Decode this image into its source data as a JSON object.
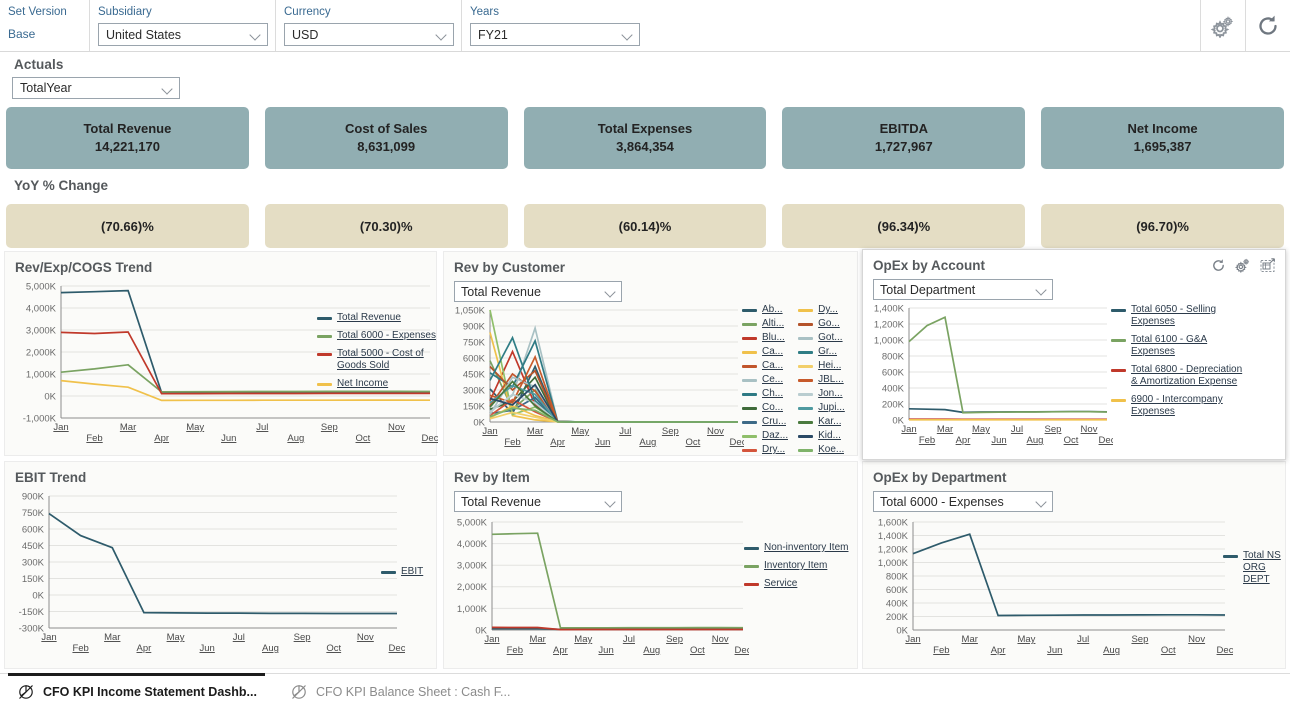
{
  "filters": {
    "set_version": {
      "label": "Set Version",
      "value": "Base"
    },
    "subsidiary": {
      "label": "Subsidiary",
      "value": "United States"
    },
    "currency": {
      "label": "Currency",
      "value": "USD"
    },
    "years": {
      "label": "Years",
      "value": "FY21"
    },
    "icons": {
      "settings": "gear-icon",
      "refresh": "refresh-icon"
    }
  },
  "actuals": {
    "title": "Actuals",
    "period_selector": "TotalYear",
    "kpis": [
      {
        "label": "Total Revenue",
        "value": "14,221,170"
      },
      {
        "label": "Cost of Sales",
        "value": "8,631,099"
      },
      {
        "label": "Total Expenses",
        "value": "3,864,354"
      },
      {
        "label": "EBITDA",
        "value": "1,727,967"
      },
      {
        "label": "Net Income",
        "value": "1,695,387"
      }
    ]
  },
  "yoy": {
    "title": "YoY % Change",
    "values": [
      "(70.66)%",
      "(70.30)%",
      "(60.14)%",
      "(96.34)%",
      "(96.70)%"
    ]
  },
  "colors": {
    "kpi_tile": "#91aeb2",
    "yoy_tile": "#e4ddc4",
    "teal": "#2e5b6b",
    "green": "#7aa362",
    "red": "#c0392b",
    "yellow": "#f0c14b",
    "label_blue": "#3a6a91"
  },
  "months": [
    "Jan",
    "Feb",
    "Mar",
    "Apr",
    "May",
    "Jun",
    "Jul",
    "Aug",
    "Sep",
    "Oct",
    "Nov",
    "Dec"
  ],
  "chart_data": [
    {
      "id": "rev_exp_cogs_trend",
      "type": "line",
      "title": "Rev/Exp/COGS Trend",
      "x": [
        "Jan",
        "Feb",
        "Mar",
        "Apr",
        "May",
        "Jun",
        "Jul",
        "Aug",
        "Sep",
        "Oct",
        "Nov",
        "Dec"
      ],
      "xlabel": "",
      "ylabel": "",
      "ylim": [
        -1000,
        5000
      ],
      "yticks": [
        "5,000K",
        "4,000K",
        "3,000K",
        "2,000K",
        "1,000K",
        "0K",
        "-1,000K"
      ],
      "grid": true,
      "legend_position": "right",
      "series": [
        {
          "name": "Total Revenue",
          "color": "#2e5b6b",
          "values": [
            4700,
            4740,
            4790,
            150,
            160,
            160,
            165,
            165,
            165,
            165,
            165,
            160
          ]
        },
        {
          "name": "Total 6000 - Expenses",
          "color": "#7aa362",
          "values": [
            1080,
            1230,
            1420,
            185,
            195,
            200,
            205,
            205,
            208,
            210,
            210,
            205
          ]
        },
        {
          "name": "Total 5000 - Cost of Goods Sold",
          "color": "#c0392b",
          "values": [
            2890,
            2840,
            2910,
            105,
            110,
            112,
            115,
            115,
            118,
            120,
            120,
            118
          ]
        },
        {
          "name": "Net Income",
          "color": "#f0c14b",
          "values": [
            700,
            540,
            400,
            -200,
            -195,
            -195,
            -190,
            -190,
            -190,
            -188,
            -188,
            -190
          ]
        }
      ]
    },
    {
      "id": "rev_by_customer",
      "type": "line",
      "title": "Rev by Customer",
      "selector": "Total Revenue",
      "x": [
        "Jan",
        "Feb",
        "Mar",
        "Apr",
        "May",
        "Jun",
        "Jul",
        "Aug",
        "Sep",
        "Oct",
        "Nov",
        "Dec"
      ],
      "ylim": [
        0,
        1050
      ],
      "yticks": [
        "1,050K",
        "900K",
        "750K",
        "600K",
        "450K",
        "300K",
        "150K",
        "0K"
      ],
      "grid": true,
      "legend_position": "right",
      "legend_columns": 2,
      "series": [
        {
          "name": "Ab...",
          "color": "#2e5b6b",
          "values": [
            310,
            80,
            520,
            5,
            0,
            0,
            0,
            0,
            0,
            0,
            0,
            0
          ]
        },
        {
          "name": "Alti...",
          "color": "#7aa362",
          "values": [
            575,
            120,
            300,
            4,
            0,
            0,
            0,
            0,
            0,
            0,
            0,
            0
          ]
        },
        {
          "name": "Blu...",
          "color": "#c0392b",
          "values": [
            200,
            660,
            160,
            3,
            0,
            0,
            0,
            0,
            0,
            0,
            0,
            0
          ]
        },
        {
          "name": "Ca...",
          "color": "#f0c14b",
          "values": [
            840,
            60,
            20,
            2,
            0,
            0,
            0,
            0,
            0,
            0,
            0,
            0
          ]
        },
        {
          "name": "Ca...",
          "color": "#c1552c",
          "values": [
            150,
            450,
            290,
            3,
            0,
            0,
            0,
            0,
            0,
            0,
            0,
            0
          ]
        },
        {
          "name": "Ce...",
          "color": "#a9c1c4",
          "values": [
            100,
            250,
            880,
            4,
            0,
            0,
            0,
            0,
            0,
            0,
            0,
            0
          ]
        },
        {
          "name": "Ch...",
          "color": "#2e7a84",
          "values": [
            460,
            330,
            760,
            6,
            0,
            0,
            0,
            0,
            0,
            0,
            0,
            0
          ]
        },
        {
          "name": "Co...",
          "color": "#3f6b3a",
          "values": [
            120,
            190,
            420,
            3,
            0,
            0,
            0,
            0,
            0,
            0,
            0,
            0
          ]
        },
        {
          "name": "Cru...",
          "color": "#3d6a87",
          "values": [
            80,
            110,
            230,
            2,
            0,
            0,
            0,
            0,
            0,
            0,
            0,
            0
          ]
        },
        {
          "name": "Daz...",
          "color": "#8fbf6a",
          "values": [
            1050,
            70,
            140,
            2,
            0,
            0,
            0,
            0,
            0,
            0,
            0,
            0
          ]
        },
        {
          "name": "Dry...",
          "color": "#d4553c",
          "values": [
            60,
            210,
            95,
            2,
            0,
            0,
            0,
            0,
            0,
            0,
            0,
            0
          ]
        },
        {
          "name": "Dy...",
          "color": "#f0c14b",
          "values": [
            40,
            150,
            60,
            1,
            0,
            0,
            0,
            0,
            0,
            0,
            0,
            0
          ]
        },
        {
          "name": "Go...",
          "color": "#b4532a",
          "values": [
            520,
            300,
            480,
            4,
            0,
            0,
            0,
            0,
            0,
            0,
            0,
            0
          ]
        },
        {
          "name": "Got...",
          "color": "#a9c1c4",
          "values": [
            70,
            420,
            330,
            3,
            0,
            0,
            0,
            0,
            0,
            0,
            0,
            0
          ]
        },
        {
          "name": "Gr...",
          "color": "#2f7d85",
          "values": [
            390,
            790,
            200,
            5,
            0,
            0,
            0,
            0,
            0,
            0,
            0,
            0
          ]
        },
        {
          "name": "Hei...",
          "color": "#f2cf6a",
          "values": [
            30,
            90,
            45,
            1,
            0,
            0,
            0,
            0,
            0,
            0,
            0,
            0
          ]
        },
        {
          "name": "JBL...",
          "color": "#c75a2b",
          "values": [
            250,
            180,
            610,
            4,
            0,
            0,
            0,
            0,
            0,
            0,
            0,
            0
          ]
        },
        {
          "name": "Jon...",
          "color": "#b9cdd0",
          "values": [
            90,
            260,
            180,
            2,
            0,
            0,
            0,
            0,
            0,
            0,
            0,
            0
          ]
        },
        {
          "name": "Jupi...",
          "color": "#4f9aa0",
          "values": [
            180,
            340,
            260,
            3,
            0,
            0,
            0,
            0,
            0,
            0,
            0,
            0
          ]
        },
        {
          "name": "Kar...",
          "color": "#4a7a3e",
          "values": [
            140,
            380,
            150,
            2,
            0,
            0,
            0,
            0,
            0,
            0,
            0,
            0
          ]
        },
        {
          "name": "Kid...",
          "color": "#2b4a66",
          "values": [
            220,
            160,
            350,
            3,
            0,
            0,
            0,
            0,
            0,
            0,
            0,
            0
          ]
        },
        {
          "name": "Koe...",
          "color": "#7fb36a",
          "values": [
            50,
            130,
            110,
            2,
            0,
            0,
            0,
            0,
            0,
            0,
            0,
            0
          ]
        }
      ]
    },
    {
      "id": "opex_by_account",
      "type": "line",
      "title": "OpEx by Account",
      "selector": "Total Department",
      "x": [
        "Jan",
        "Feb",
        "Mar",
        "Apr",
        "May",
        "Jun",
        "Jul",
        "Aug",
        "Sep",
        "Oct",
        "Nov",
        "Dec"
      ],
      "ylim": [
        0,
        1400
      ],
      "yticks": [
        "1,400K",
        "1,200K",
        "1,000K",
        "800K",
        "600K",
        "400K",
        "200K",
        "0K"
      ],
      "grid": true,
      "legend_position": "right",
      "icons": [
        "refresh-icon",
        "gear-icon",
        "expand-icon"
      ],
      "series": [
        {
          "name": "Total 6050 - Selling Expenses",
          "color": "#2e5b6b",
          "values": [
            140,
            135,
            130,
            95,
            100,
            100,
            102,
            102,
            104,
            105,
            105,
            103
          ]
        },
        {
          "name": "Total 6100 - G&A Expenses",
          "color": "#7aa362",
          "values": [
            980,
            1180,
            1285,
            90,
            95,
            97,
            100,
            100,
            102,
            104,
            104,
            100
          ]
        },
        {
          "name": "Total 6800 - Depreciation & Amortization Expense",
          "color": "#c0392b",
          "values": [
            10,
            10,
            10,
            8,
            8,
            8,
            8,
            8,
            8,
            8,
            8,
            8
          ]
        },
        {
          "name": "6900 - Intercompany Expenses",
          "color": "#f0c14b",
          "values": [
            2,
            2,
            2,
            2,
            2,
            2,
            2,
            2,
            2,
            2,
            2,
            2
          ]
        }
      ]
    },
    {
      "id": "ebit_trend",
      "type": "line",
      "title": "EBIT Trend",
      "x": [
        "Jan",
        "Feb",
        "Mar",
        "Apr",
        "May",
        "Jun",
        "Jul",
        "Aug",
        "Sep",
        "Oct",
        "Nov",
        "Dec"
      ],
      "ylim": [
        -300,
        900
      ],
      "yticks": [
        "900K",
        "750K",
        "600K",
        "450K",
        "300K",
        "150K",
        "0K",
        "-150K",
        "-300K"
      ],
      "grid": true,
      "legend_position": "right",
      "series": [
        {
          "name": "EBIT",
          "color": "#2e5b6b",
          "values": [
            740,
            540,
            430,
            -160,
            -163,
            -165,
            -165,
            -167,
            -167,
            -168,
            -168,
            -168
          ]
        }
      ]
    },
    {
      "id": "rev_by_item",
      "type": "line",
      "title": "Rev by Item",
      "selector": "Total Revenue",
      "x": [
        "Jan",
        "Feb",
        "Mar",
        "Apr",
        "May",
        "Jun",
        "Jul",
        "Aug",
        "Sep",
        "Oct",
        "Nov",
        "Dec"
      ],
      "ylim": [
        0,
        5000
      ],
      "yticks": [
        "5,000K",
        "4,000K",
        "3,000K",
        "2,000K",
        "1,000K",
        "0K"
      ],
      "grid": true,
      "legend_position": "right",
      "series": [
        {
          "name": "Non-inventory Item",
          "color": "#2e5b6b",
          "values": [
            60,
            62,
            65,
            30,
            32,
            33,
            34,
            34,
            35,
            35,
            35,
            34
          ]
        },
        {
          "name": "Inventory Item",
          "color": "#7aa362",
          "values": [
            4430,
            4460,
            4480,
            95,
            100,
            103,
            105,
            105,
            108,
            110,
            110,
            106
          ]
        },
        {
          "name": "Service",
          "color": "#c0392b",
          "values": [
            120,
            118,
            115,
            20,
            21,
            21,
            22,
            22,
            22,
            22,
            22,
            21
          ]
        }
      ]
    },
    {
      "id": "opex_by_department",
      "type": "line",
      "title": "OpEx by Department",
      "selector": "Total 6000 - Expenses",
      "x": [
        "Jan",
        "Feb",
        "Mar",
        "Apr",
        "May",
        "Jun",
        "Jul",
        "Aug",
        "Sep",
        "Oct",
        "Nov",
        "Dec"
      ],
      "ylim": [
        0,
        1600
      ],
      "yticks": [
        "1,600K",
        "1,400K",
        "1,200K",
        "1,000K",
        "800K",
        "600K",
        "400K",
        "200K",
        "0K"
      ],
      "grid": true,
      "legend_position": "right",
      "series": [
        {
          "name": "Total NS ORG DEPT",
          "color": "#2e5b6b",
          "values": [
            1130,
            1290,
            1420,
            215,
            218,
            220,
            222,
            222,
            224,
            225,
            225,
            222
          ]
        }
      ]
    }
  ],
  "taskbar": {
    "tabs": [
      {
        "label": "CFO KPI Income Statement Dashb...",
        "active": true
      },
      {
        "label": "CFO KPI Balance Sheet : Cash F...",
        "active": false
      }
    ]
  }
}
